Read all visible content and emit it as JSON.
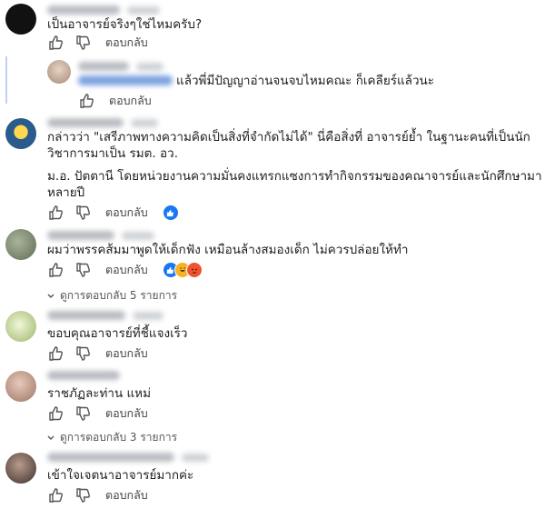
{
  "comments": [
    {
      "text": "เป็นอาจารย์จริงๆใช่ไหมครับ?",
      "reply_label": "ตอบกลับ"
    },
    {
      "text": "แล้วพี่มีปัญญาอ่านจนจบไหมคณะ ก็เคลียร์แล้วนะ",
      "reply_label": "ตอบกลับ"
    },
    {
      "text_lines": [
        "กล่าวว่า \"เสรีภาพทางความคิดเป็นสิ่งที่จำกัดไม่ได้\" นี่คือสิ่งที่ อาจารย์ย้ำ ในฐานะคนที่เป็นนัก",
        "วิชาการมาเป็น รมต. อว.",
        "ม.อ. ปัตตานี โดยหน่วยงานความมั่นคงแทรกแซงการทำกิจกรรมของคณาจารย์และนักศึกษามา",
        "หลายปี"
      ],
      "reply_label": "ตอบกลับ"
    },
    {
      "text": "ผมว่าพรรคส้มมาพูดให้เด็กฟัง เหมือนล้างสมองเด็ก ไม่ควรปล่อยให้ทำ",
      "reply_label": "ตอบกลับ",
      "view_replies": "ดูการตอบกลับ 5 รายการ"
    },
    {
      "text": "ขอบคุณอาจารย์ที่ชี้แจงเร็ว",
      "reply_label": "ตอบกลับ"
    },
    {
      "text": "ราชภัฏละท่าน แหม่",
      "reply_label": "ตอบกลับ",
      "view_replies": "ดูการตอบกลับ 3 รายการ"
    },
    {
      "text": "เข้าใจเจตนาอาจารย์มากค่ะ",
      "reply_label": "ตอบกลับ"
    }
  ],
  "colors": {
    "like_blue": "#1877f2",
    "angry_orange": "#f0532d",
    "haha_yellow": "#f7b125",
    "reply_line": "#bfd2f2"
  }
}
